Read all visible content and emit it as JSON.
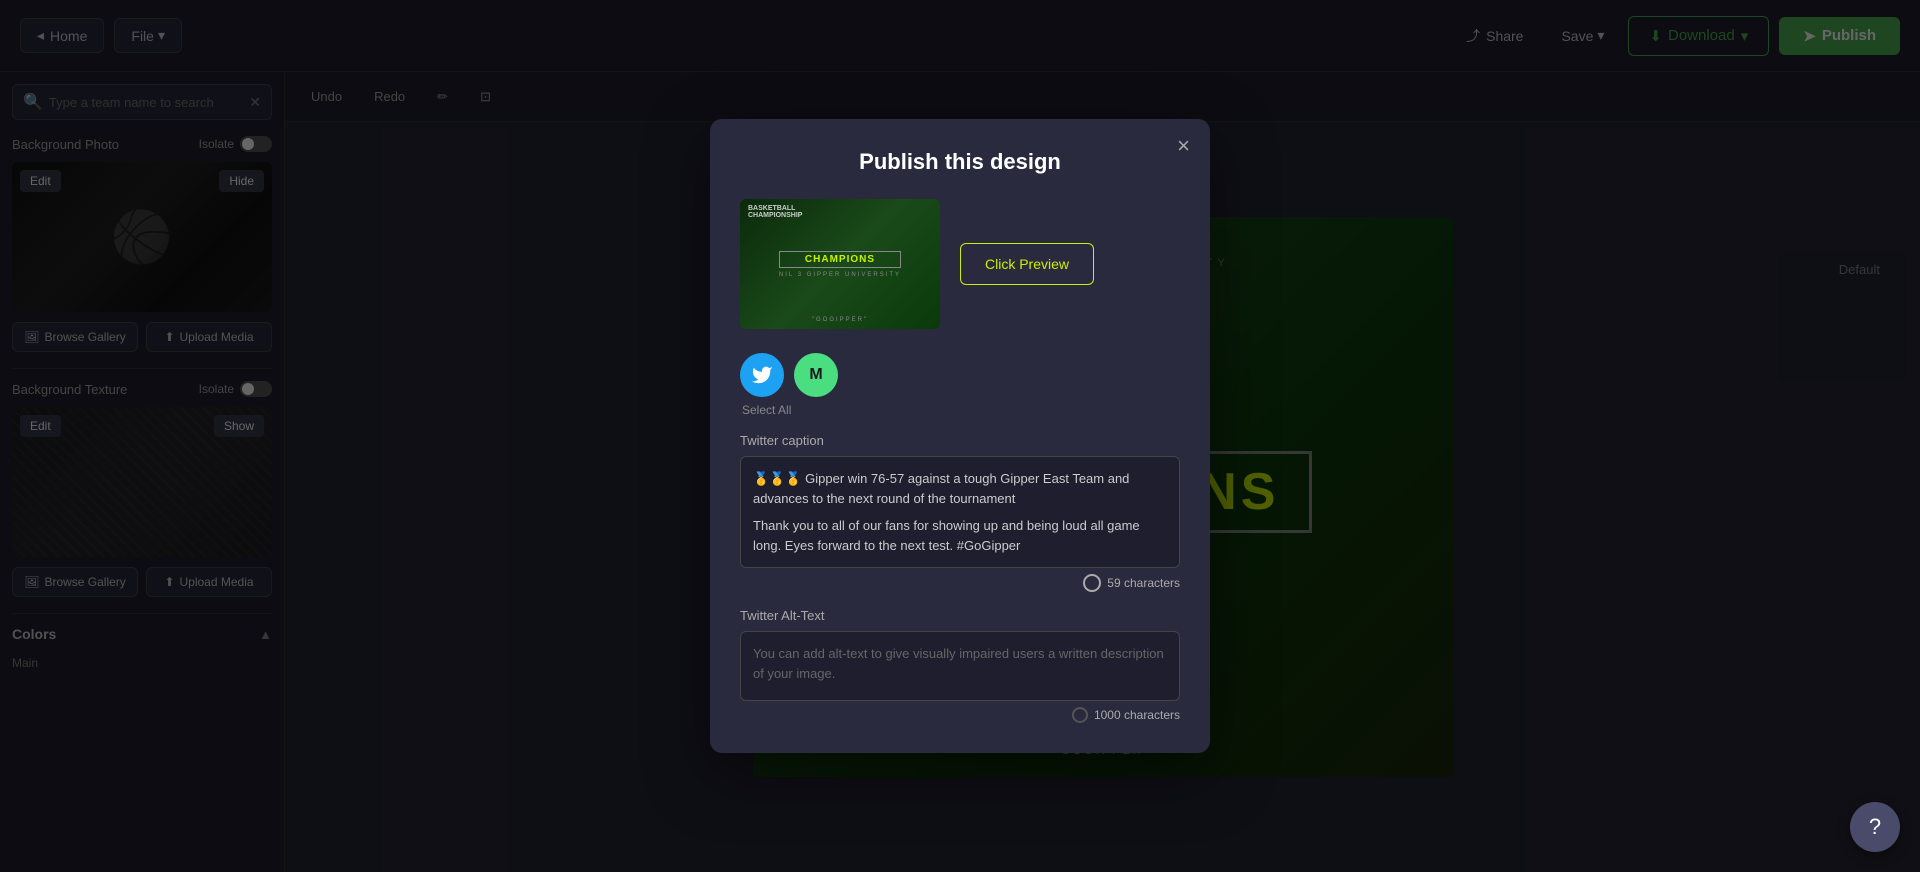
{
  "topbar": {
    "home_label": "Home",
    "file_label": "File",
    "share_label": "Share",
    "save_label": "Save",
    "download_label": "Download",
    "publish_label": "Publish",
    "default_label": "Default"
  },
  "toolbar": {
    "undo_label": "Undo",
    "redo_label": "Redo"
  },
  "left_panel": {
    "search_placeholder": "Type a team name to search",
    "background_photo_label": "Background Photo",
    "isolate_label": "Isolate",
    "hide_label": "Hide",
    "edit_label": "Edit",
    "browse_gallery_label": "Browse Gallery",
    "upload_media_label": "Upload Media",
    "background_texture_label": "Background Texture",
    "show_label": "Show",
    "colors_label": "Colors",
    "main_label": "Main"
  },
  "modal": {
    "title": "Publish this design",
    "close_label": "×",
    "click_preview_label": "Click Preview",
    "select_all_label": "Select All",
    "twitter_caption_label": "Twitter caption",
    "caption_text_line1": "🥇🥇🥇 Gipper win 76-57 against a tough Gipper East Team and advances to the next round of the tournament",
    "caption_text_line2": "Thank you to all of our fans for showing up and being loud all game long. Eyes forward to the next test. #GoGipper",
    "char_count": "59 characters",
    "twitter_alt_text_label": "Twitter Alt-Text",
    "alt_text_placeholder": "You can add alt-text to give visually impaired users a written description of your image.",
    "alt_char_count": "1000 characters"
  },
  "canvas": {
    "champions_text": "CHAMPIONS",
    "university_text": "NIL 3 GIPPER UNIVERSITY",
    "gogipper_text": "\"GOGIPPER\""
  }
}
